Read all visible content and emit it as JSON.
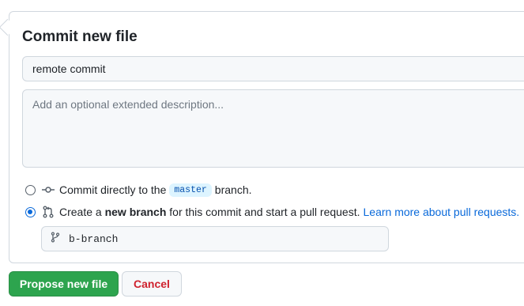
{
  "form": {
    "title": "Commit new file",
    "summary_value": "remote commit",
    "description_placeholder": "Add an optional extended description..."
  },
  "options": {
    "direct": {
      "prefix": "Commit directly to the",
      "branch_name": "master",
      "suffix": "branch.",
      "checked": false
    },
    "new_branch": {
      "prefix": "Create a",
      "bold": "new branch",
      "suffix": "for this commit and start a pull request.",
      "link": "Learn more about pull requests.",
      "checked": true
    }
  },
  "branch_input": {
    "value": "b-branch"
  },
  "buttons": {
    "propose": "Propose new file",
    "cancel": "Cancel"
  },
  "colors": {
    "primary": "#2da44e",
    "link": "#0969da",
    "danger": "#cf222e",
    "code_bg": "#ddf4ff"
  },
  "icons": {
    "direct": "git-commit-icon",
    "new_branch": "git-pull-request-icon",
    "branch": "git-branch-icon"
  }
}
